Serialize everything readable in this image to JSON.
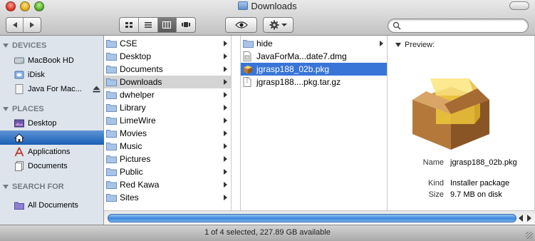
{
  "window": {
    "title": "Downloads",
    "status": "1 of 4 selected, 227.89 GB available"
  },
  "toolbar": {
    "back_icon": "back-arrow-icon",
    "forward_icon": "forward-arrow-icon",
    "view_modes": [
      "icon-view",
      "list-view",
      "column-view",
      "cover-flow-view"
    ],
    "active_view": "column-view",
    "search": {
      "value": "",
      "placeholder": ""
    }
  },
  "sidebar": {
    "sections": [
      {
        "header": "DEVICES",
        "items": [
          {
            "label": "MacBook HD",
            "icon": "hard-disk-icon"
          },
          {
            "label": "iDisk",
            "icon": "idisk-icon"
          },
          {
            "label": "Java For Mac...",
            "icon": "disk-image-icon",
            "eject": true
          }
        ]
      },
      {
        "header": "PLACES",
        "items": [
          {
            "label": "Desktop",
            "icon": "desktop-icon"
          },
          {
            "label": "",
            "icon": "home-icon",
            "selected": true
          },
          {
            "label": "Applications",
            "icon": "applications-icon"
          },
          {
            "label": "Documents",
            "icon": "documents-icon"
          }
        ]
      },
      {
        "header": "SEARCH FOR",
        "items": [
          {
            "label": "All Documents",
            "icon": "smart-folder-icon"
          }
        ]
      }
    ]
  },
  "columns": {
    "home": [
      "CSE",
      "Desktop",
      "Documents",
      "Downloads",
      "dwhelper",
      "Library",
      "LimeWire",
      "Movies",
      "Music",
      "Pictures",
      "Public",
      "Red Kawa",
      "Sites"
    ],
    "home_selected": "Downloads",
    "downloads": [
      {
        "label": "hide",
        "icon": "folder-icon",
        "arrow": true
      },
      {
        "label": "JavaForMa...date7.dmg",
        "icon": "dmg-file-icon"
      },
      {
        "label": "jgrasp188_02b.pkg",
        "icon": "package-icon",
        "active": true
      },
      {
        "label": "jgrasp188....pkg.tar.gz",
        "icon": "archive-file-icon"
      }
    ]
  },
  "preview": {
    "header": "Preview:",
    "image_icon": "installer-package-icon",
    "info": [
      {
        "key": "Name",
        "value": "jgrasp188_02b.pkg"
      },
      {
        "key": "Kind",
        "value": "Installer package"
      },
      {
        "key": "Size",
        "value": "9.7 MB on disk"
      }
    ]
  },
  "colors": {
    "selection_blue": "#3875d7",
    "sidebar_bg": "#dde4ec",
    "scroll_thumb": "#3a87dc"
  }
}
